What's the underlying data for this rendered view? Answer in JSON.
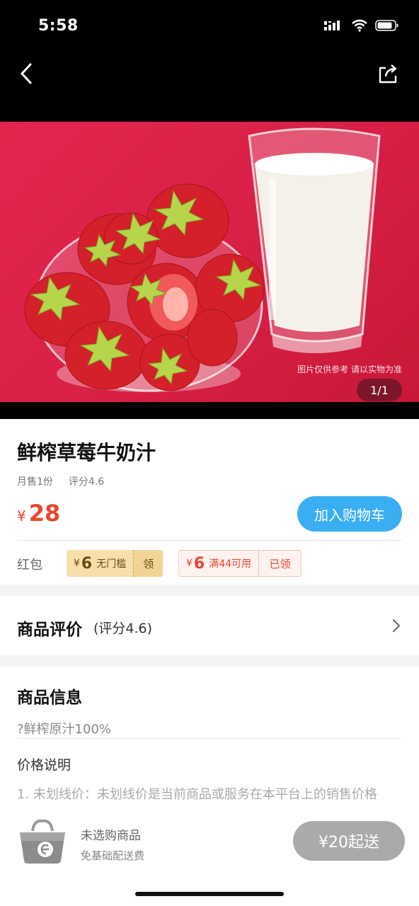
{
  "status_bar": {
    "time": "5:58"
  },
  "hero": {
    "note": "图片仅供参考 请以实物为准",
    "counter": "1/1"
  },
  "product": {
    "title": "鲜榨草莓牛奶汁",
    "monthly_sales": "月售1份",
    "rating": "评分4.6",
    "currency": "¥",
    "price": "28",
    "add_to_cart": "加入购物车"
  },
  "red_packet": {
    "label": "红包",
    "coupons": [
      {
        "currency": "¥",
        "amount": "6",
        "condition": "无门槛",
        "action": "领"
      },
      {
        "currency": "¥",
        "amount": "6",
        "condition": "满44可用",
        "action": "已领"
      }
    ]
  },
  "reviews": {
    "title": "商品评价",
    "score": "(评分4.6)"
  },
  "info": {
    "title": "商品信息",
    "description": "?鲜榨原汁100%",
    "price_note_title": "价格说明",
    "price_note_text": "1. 未划线价：未划线价是当前商品或服务在本平台上的销售价格"
  },
  "cart": {
    "empty_text": "未选购商品",
    "fee_text": "免基础配送费",
    "min_order": "¥20起送"
  },
  "colors": {
    "accent_blue": "#3aaef2",
    "price_red": "#e8452c",
    "hero_bg": "#d81f45",
    "disabled_gray": "#aaaaaa"
  }
}
